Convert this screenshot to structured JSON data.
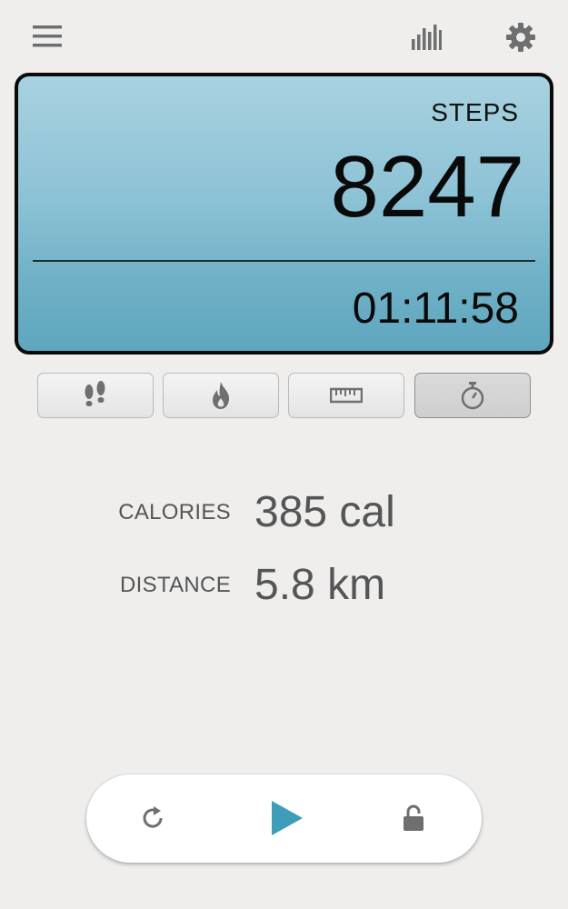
{
  "toolbar": {
    "menu_icon": "hamburger-menu-icon",
    "stats_icon": "bar-chart-icon",
    "settings_icon": "gear-icon"
  },
  "display": {
    "label": "STEPS",
    "steps": "8247",
    "elapsed_time": "01:11:58"
  },
  "modes": [
    {
      "name": "steps",
      "icon": "footprints-icon",
      "active": false
    },
    {
      "name": "calories",
      "icon": "flame-icon",
      "active": false
    },
    {
      "name": "distance",
      "icon": "ruler-icon",
      "active": false
    },
    {
      "name": "time",
      "icon": "stopwatch-icon",
      "active": true
    }
  ],
  "stats": {
    "calories_label": "CALORIES",
    "calories_value": "385 cal",
    "distance_label": "DISTANCE",
    "distance_value": "5.8 km"
  },
  "controls": {
    "reset_icon": "reset-icon",
    "play_icon": "play-icon",
    "lock_icon": "lock-icon"
  },
  "colors": {
    "background": "#efeeed",
    "display_gradient_top": "#a8d2e0",
    "display_gradient_bottom": "#5ea6bf",
    "play_accent": "#3f9db8",
    "icon_gray": "#6f6f6f"
  }
}
